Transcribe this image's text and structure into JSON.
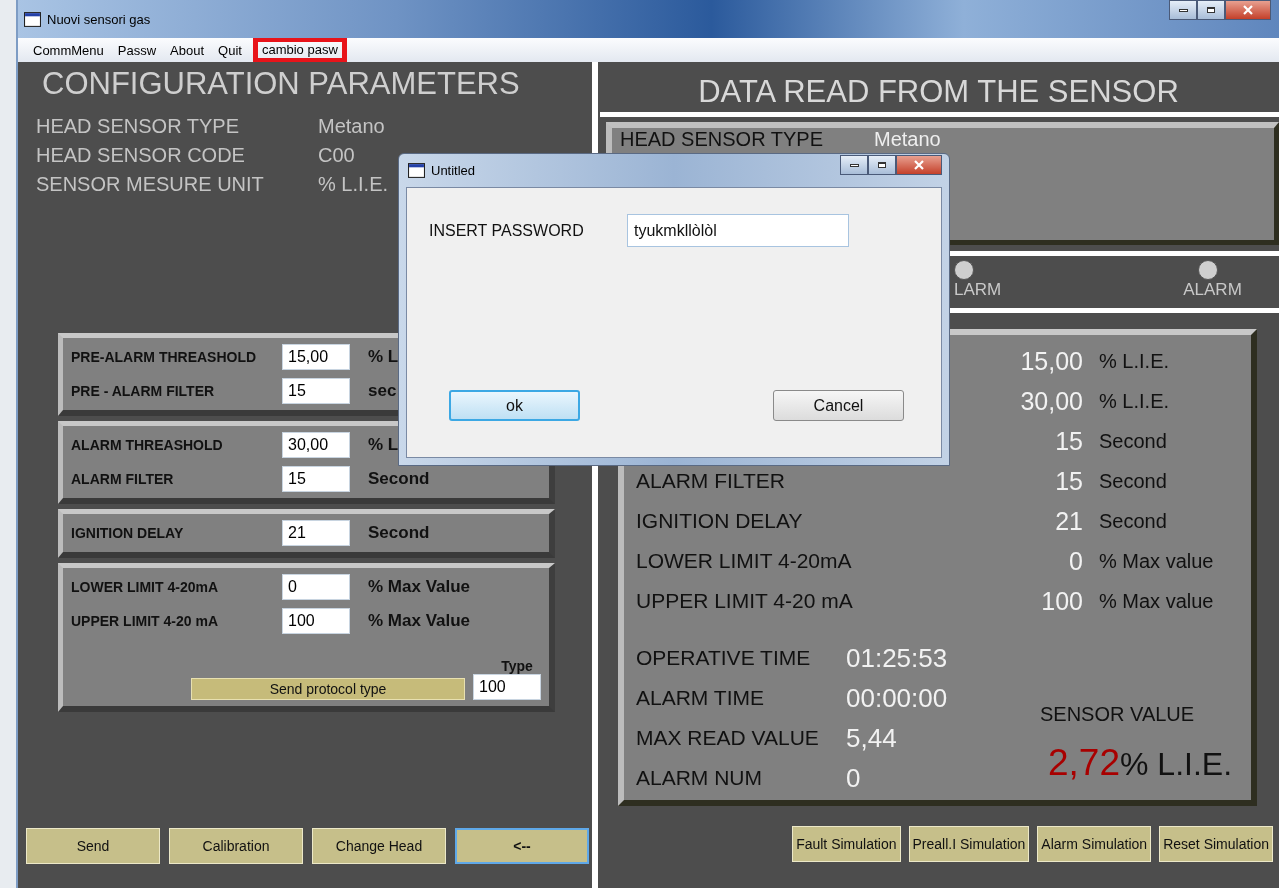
{
  "window": {
    "title": "Nuovi sensori gas"
  },
  "menu": [
    {
      "label": "CommMenu",
      "highlighted": false
    },
    {
      "label": "Passw",
      "highlighted": false
    },
    {
      "label": "About",
      "highlighted": false
    },
    {
      "label": "Quit",
      "highlighted": false
    },
    {
      "label": "cambio pasw",
      "highlighted": true
    }
  ],
  "config": {
    "title": "CONFIGURATION PARAMETERS",
    "info": [
      {
        "label": "HEAD SENSOR TYPE",
        "value": "Metano"
      },
      {
        "label": "HEAD SENSOR CODE",
        "value": "C00"
      },
      {
        "label": "SENSOR MESURE UNIT",
        "value": "% L.I.E."
      }
    ],
    "groups": [
      {
        "rows": [
          {
            "label": "PRE-ALARM THREASHOLD",
            "value": "15,00",
            "unit": "% L"
          },
          {
            "label": "PRE - ALARM FILTER",
            "value": "15",
            "unit": "sec"
          }
        ]
      },
      {
        "rows": [
          {
            "label": "ALARM THREASHOLD",
            "value": "30,00",
            "unit": "% L"
          },
          {
            "label": "ALARM FILTER",
            "value": "15",
            "unit": "Second"
          }
        ]
      },
      {
        "rows": [
          {
            "label": "IGNITION DELAY",
            "value": "21",
            "unit": "Second"
          }
        ]
      },
      {
        "rows": [
          {
            "label": "LOWER LIMIT 4-20mA",
            "value": "0",
            "unit": "% Max Value"
          },
          {
            "label": "UPPER LIMIT 4-20 mA",
            "value": "100",
            "unit": "% Max Value"
          }
        ],
        "protocol": {
          "type_label": "Type",
          "button": "Send protocol type",
          "type_value": "100"
        }
      }
    ]
  },
  "left_buttons": [
    {
      "label": "Send",
      "focused": false
    },
    {
      "label": "Calibration",
      "focused": false
    },
    {
      "label": "Change Head",
      "focused": false
    },
    {
      "label": "<--",
      "focused": true
    }
  ],
  "readout": {
    "title": "DATA READ FROM THE SENSOR",
    "head": [
      {
        "label": "HEAD SENSOR TYPE",
        "value": "Metano"
      }
    ],
    "indicators": [
      {
        "label": "LARM",
        "on": false
      },
      {
        "label": "ALARM",
        "on": false
      }
    ],
    "rows": [
      {
        "value": "15,00",
        "unit": "% L.I.E."
      },
      {
        "value": "30,00",
        "unit": "% L.I.E."
      },
      {
        "value": "15",
        "unit": "Second"
      },
      {
        "label": "ALARM FILTER",
        "value": "15",
        "unit": "Second"
      },
      {
        "label": "IGNITION DELAY",
        "value": "21",
        "unit": "Second"
      },
      {
        "label": "LOWER LIMIT 4-20mA",
        "value": "0",
        "unit": "% Max value"
      },
      {
        "label": "UPPER LIMIT 4-20 mA",
        "value": "100",
        "unit": "% Max value"
      }
    ],
    "times": [
      {
        "label": "OPERATIVE TIME",
        "value": "01:25:53"
      },
      {
        "label": "ALARM TIME",
        "value": "00:00:00"
      },
      {
        "label": "MAX READ VALUE",
        "value": "5,44"
      },
      {
        "label": "ALARM NUM",
        "value": "0"
      }
    ],
    "sensor": {
      "label": "SENSOR VALUE",
      "value": "2,72",
      "unit": "% L.I.E."
    }
  },
  "sim_buttons": [
    "Fault Simulation",
    "Preall.I Simulation",
    "Alarm Simulation",
    "Reset Simulation"
  ],
  "dialog": {
    "title": "Untitled",
    "label": "INSERT PASSWORD",
    "value": "tyukmkllòlòl",
    "buttons": [
      {
        "label": "ok",
        "default": true
      },
      {
        "label": "Cancel",
        "default": false
      }
    ]
  }
}
